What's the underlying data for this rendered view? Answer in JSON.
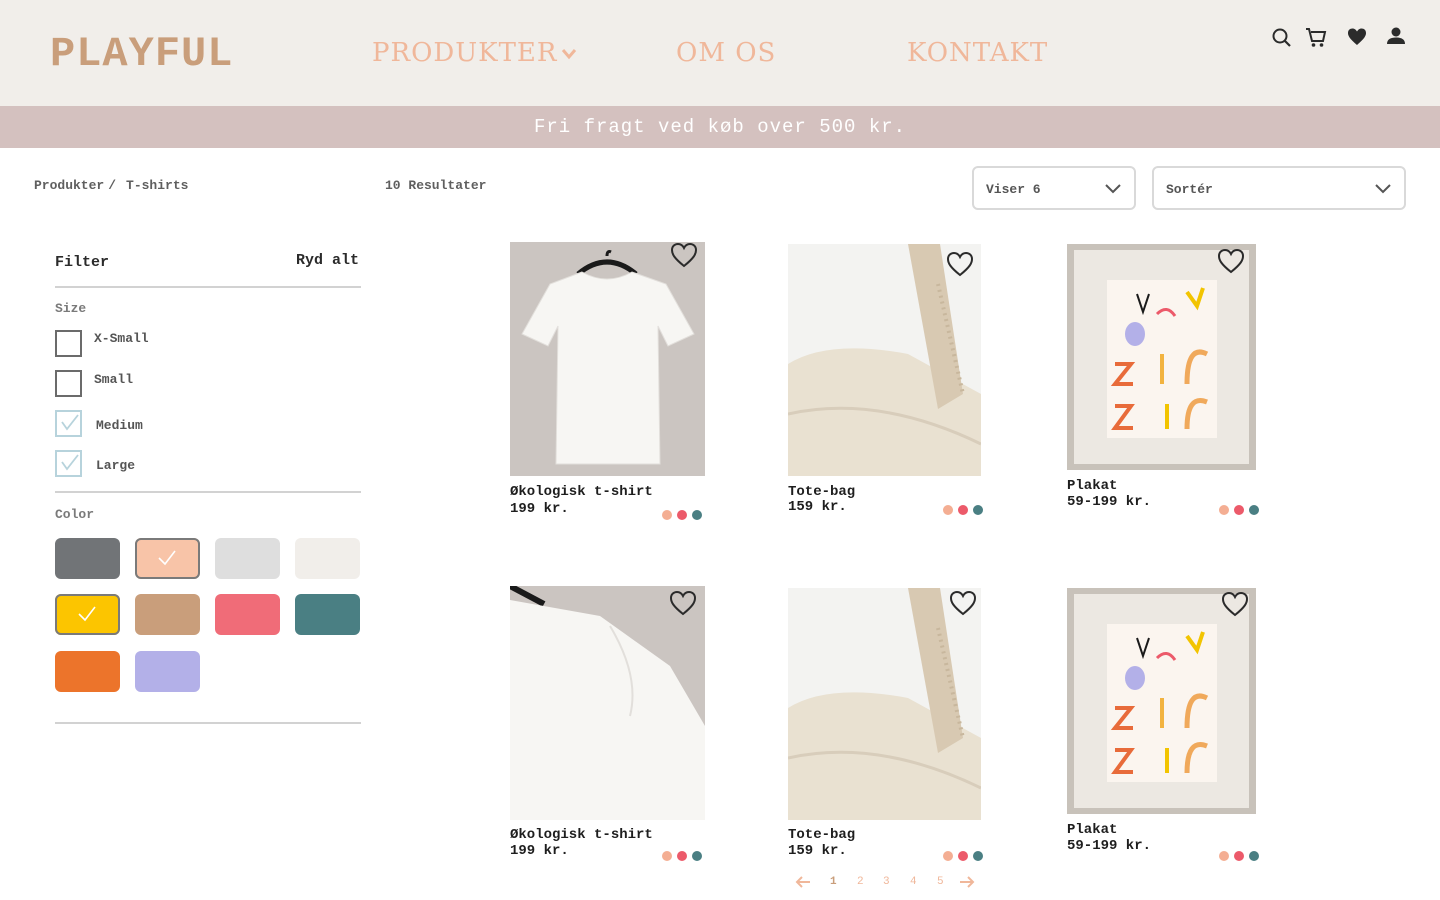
{
  "brand": "PLAYFUL",
  "nav": {
    "products": "PRODUKTER",
    "about": "OM OS",
    "contact": "KONTAKT"
  },
  "header_icons": [
    "search-icon",
    "cart-icon",
    "heart-icon",
    "user-icon"
  ],
  "banner": "Fri fragt ved køb over 500 kr.",
  "breadcrumb": {
    "root": "Produkter",
    "separator": "/",
    "current": "T-shirts"
  },
  "results": "10 Resultater",
  "controls": {
    "show": "Viser 6",
    "sort": "Sortér"
  },
  "filter": {
    "title": "Filter",
    "clear": "Ryd alt",
    "size_title": "Size",
    "sizes": [
      {
        "label": "X-Small",
        "checked": false
      },
      {
        "label": "Small",
        "checked": false
      },
      {
        "label": "Medium",
        "checked": true
      },
      {
        "label": "Large",
        "checked": true
      }
    ],
    "color_title": "Color",
    "colors": [
      {
        "name": "grey",
        "hex": "#717477",
        "selected": false
      },
      {
        "name": "peach",
        "hex": "#f8c4a8",
        "selected": true
      },
      {
        "name": "light-grey",
        "hex": "#dedede",
        "selected": false
      },
      {
        "name": "off-white",
        "hex": "#f1eeea",
        "selected": false
      },
      {
        "name": "yellow",
        "hex": "#fcc500",
        "selected": true
      },
      {
        "name": "tan",
        "hex": "#c99e7b",
        "selected": false
      },
      {
        "name": "pink",
        "hex": "#f06c78",
        "selected": false
      },
      {
        "name": "teal",
        "hex": "#4a7f83",
        "selected": false
      },
      {
        "name": "orange",
        "hex": "#ec742b",
        "selected": false
      },
      {
        "name": "lavender",
        "hex": "#b3b0e8",
        "selected": false
      }
    ]
  },
  "products": [
    {
      "name": "Økologisk t-shirt",
      "price": "199 kr."
    },
    {
      "name": "Tote-bag",
      "price": "159 kr."
    },
    {
      "name": "Plakat",
      "price": "59-199 kr."
    },
    {
      "name": "Økologisk t-shirt",
      "price": "199 kr."
    },
    {
      "name": "Tote-bag",
      "price": "159 kr."
    },
    {
      "name": "Plakat",
      "price": "59-199 kr."
    }
  ],
  "product_dot_colors": [
    "#f4ae93",
    "#ec5a6a",
    "#4a7f83"
  ],
  "pagination": {
    "pages": [
      "1",
      "2",
      "3",
      "4",
      "5"
    ],
    "current": "1"
  }
}
